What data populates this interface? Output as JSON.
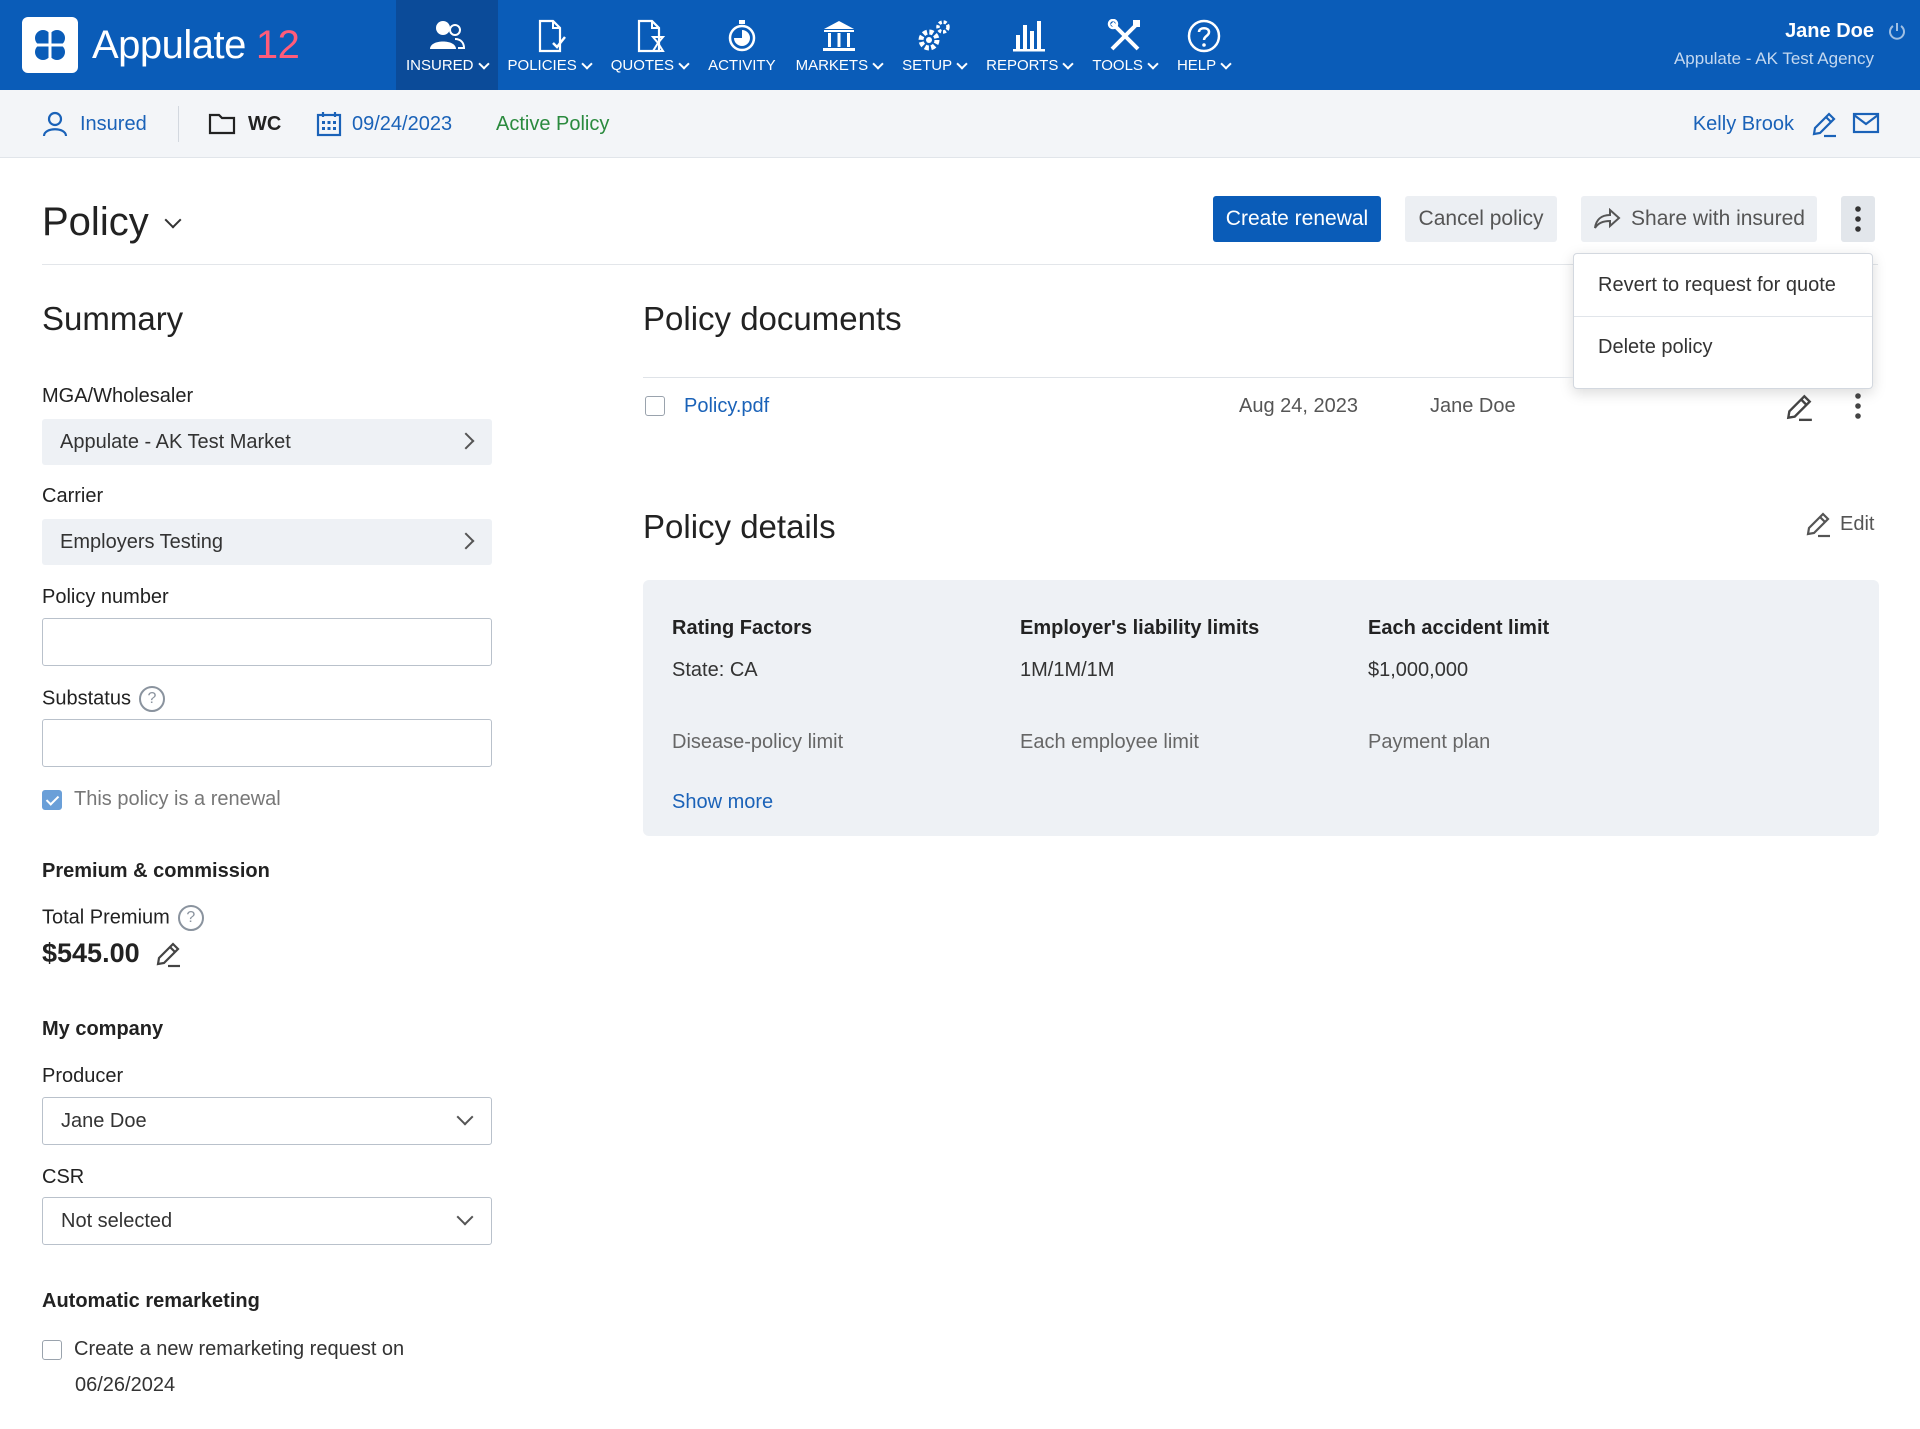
{
  "app": {
    "name": "Appulate",
    "version": "12"
  },
  "nav": [
    {
      "label": "INSURED",
      "icon": "insured-icon",
      "active": true
    },
    {
      "label": "POLICIES",
      "icon": "policies-icon"
    },
    {
      "label": "QUOTES",
      "icon": "quotes-icon"
    },
    {
      "label": "ACTIVITY",
      "icon": "activity-icon"
    },
    {
      "label": "MARKETS",
      "icon": "markets-icon"
    },
    {
      "label": "SETUP",
      "icon": "setup-icon"
    },
    {
      "label": "REPORTS",
      "icon": "reports-icon"
    },
    {
      "label": "TOOLS",
      "icon": "tools-icon"
    },
    {
      "label": "HELP",
      "icon": "help-icon"
    }
  ],
  "user": {
    "name": "Jane Doe",
    "agency": "Appulate - AK Test Agency"
  },
  "subbar": {
    "insured": "Insured",
    "lob": "WC",
    "date": "09/24/2023",
    "status": "Active Policy",
    "assigned_user": "Kelly Brook"
  },
  "page": {
    "title": "Policy"
  },
  "actions": {
    "create_renewal": "Create renewal",
    "cancel_policy": "Cancel policy",
    "share": "Share with insured"
  },
  "menu": [
    "Revert to request for quote",
    "Delete policy"
  ],
  "summary": {
    "title": "Summary",
    "mga_label": "MGA/Wholesaler",
    "mga_value": "Appulate - AK Test Market",
    "carrier_label": "Carrier",
    "carrier_value": "Employers Testing",
    "policy_number_label": "Policy number",
    "policy_number_value": "",
    "substatus_label": "Substatus",
    "substatus_value": "",
    "renewal_label": "This policy is a renewal",
    "renewal_checked": true,
    "premium_section": "Premium & commission",
    "total_premium_label": "Total Premium",
    "total_premium_value": "$545.00",
    "company_section": "My company",
    "producer_label": "Producer",
    "producer_value": "Jane Doe",
    "csr_label": "CSR",
    "csr_value": "Not selected",
    "remarketing_section": "Automatic remarketing",
    "remarketing_label": "Create a new remarketing request on",
    "remarketing_date": "06/26/2024",
    "remarketing_checked": false
  },
  "documents": {
    "title": "Policy documents",
    "items": [
      {
        "name": "Policy.pdf",
        "date": "Aug 24, 2023",
        "owner": "Jane Doe"
      }
    ]
  },
  "details": {
    "title": "Policy details",
    "edit_label": "Edit",
    "rating_factors_label": "Rating Factors",
    "rating_factors_value": "State: CA",
    "el_limits_label": "Employer's liability limits",
    "el_limits_value": "1M/1M/1M",
    "each_accident_label": "Each accident limit",
    "each_accident_value": "$1,000,000",
    "disease_policy_label": "Disease-policy limit",
    "each_employee_label": "Each employee limit",
    "payment_plan_label": "Payment plan",
    "show_more": "Show more"
  },
  "colors": {
    "brand": "#0a5cb8",
    "accent": "#ff5c7a",
    "status_active": "#2a8a3e",
    "link": "#1a62b8"
  }
}
